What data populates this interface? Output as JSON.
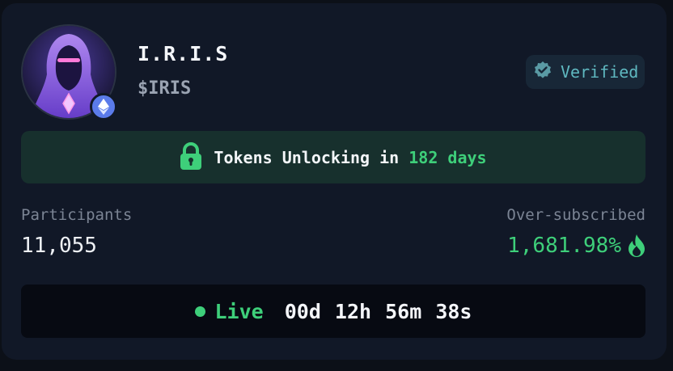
{
  "token": {
    "name": "I.R.I.S",
    "ticker": "$IRIS",
    "avatar_icon": "hooded-figure-avatar",
    "chain_icon": "ethereum-icon"
  },
  "verified": {
    "label": "Verified",
    "icon": "check-badge-icon"
  },
  "unlock": {
    "prefix": "Tokens Unlocking in",
    "days": "182 days",
    "icon": "lock-icon"
  },
  "stats": {
    "participants_label": "Participants",
    "participants_value": "11,055",
    "oversub_label": "Over-subscribed",
    "oversub_value": "1,681.98%",
    "oversub_icon": "flame-icon"
  },
  "status": {
    "label": "Live",
    "countdown": "00d 12h 56m 38s"
  },
  "colors": {
    "background": "#111827",
    "accent_green": "#3ecf7a",
    "verified_text": "#5fb8c0"
  }
}
